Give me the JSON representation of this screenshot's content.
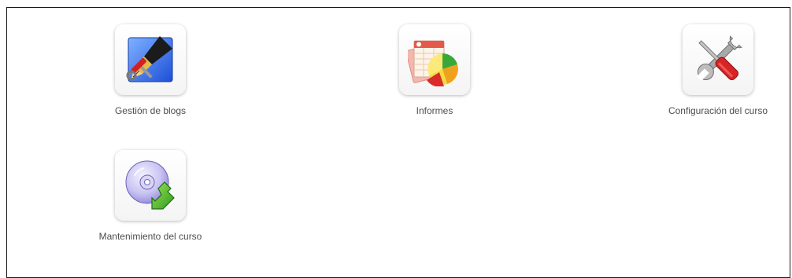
{
  "tools": [
    {
      "label": "Gestión de blogs",
      "icon": "blog-management-icon"
    },
    {
      "label": "Informes",
      "icon": "reports-chart-icon"
    },
    {
      "label": "Configuración del curso",
      "icon": "wrench-screwdriver-icon"
    },
    {
      "label": "Mantenimiento del curso",
      "icon": "disc-download-icon"
    }
  ]
}
